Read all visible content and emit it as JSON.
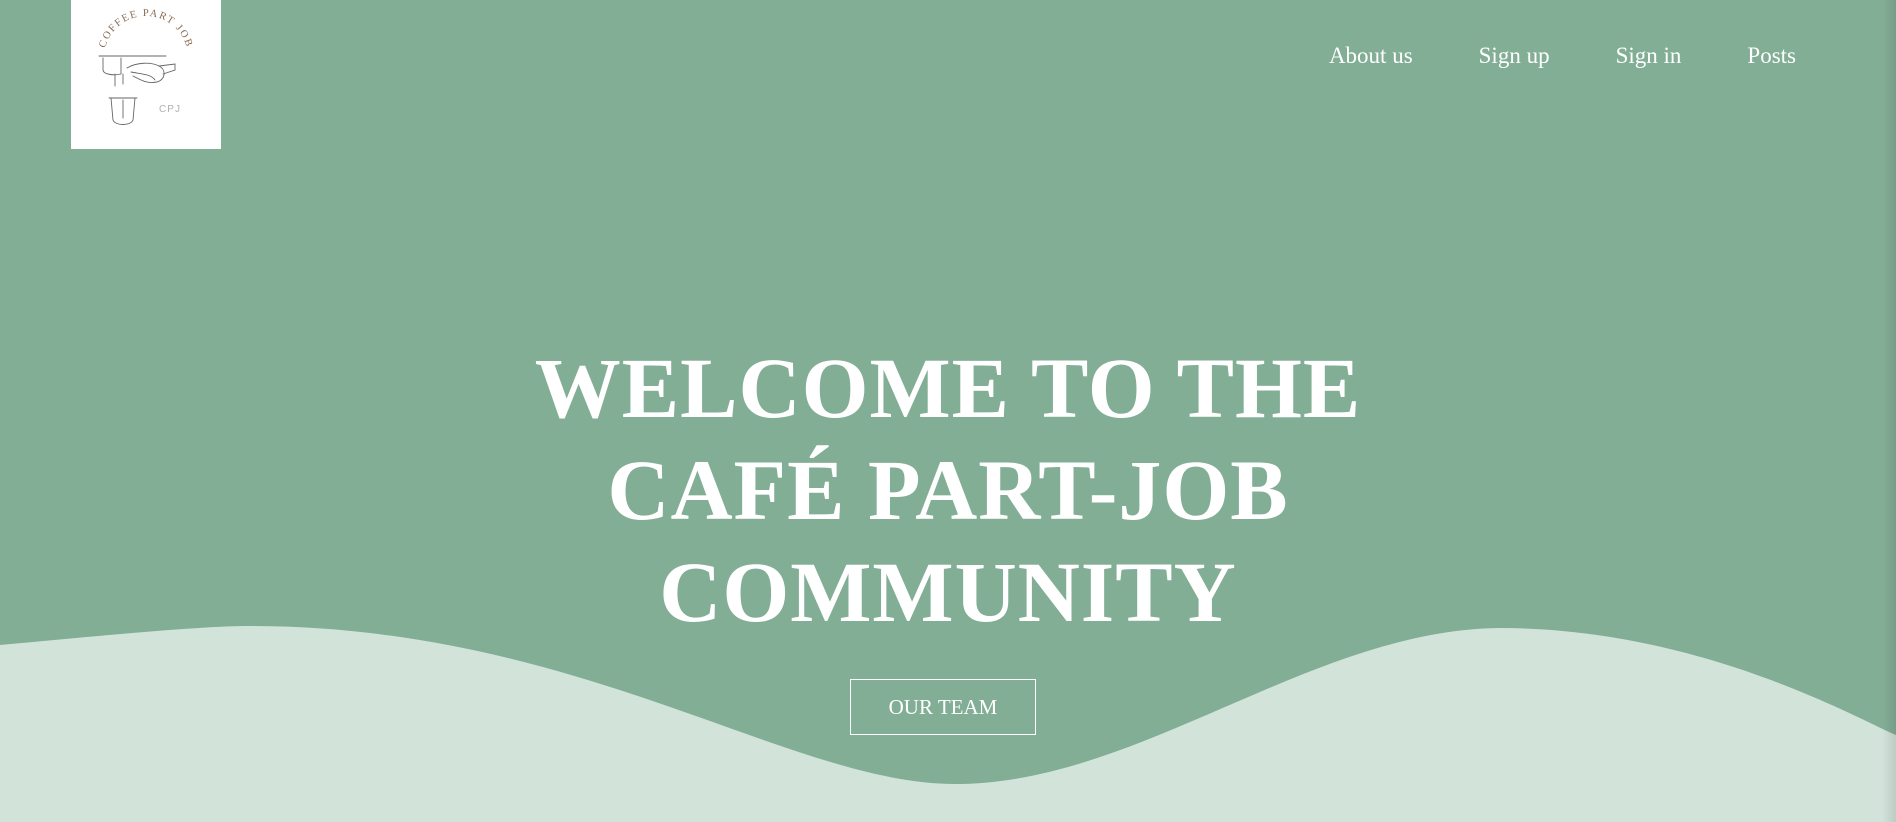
{
  "logo": {
    "alt": "Coffee Part Job logo",
    "arc_text": "COFFEE PART JOB",
    "monogram": "CPJ"
  },
  "nav": {
    "items": [
      {
        "label": "About us"
      },
      {
        "label": "Sign up"
      },
      {
        "label": "Sign in"
      },
      {
        "label": "Posts"
      }
    ]
  },
  "hero": {
    "title_line1": "WELCOME TO THE",
    "title_line2": "CAFÉ PART-JOB",
    "title_line3": "COMMUNITY",
    "button_label": "OUR TEAM"
  },
  "colors": {
    "hero_background": "#83ae96",
    "wave_fill": "#d2e3da",
    "text": "#ffffff",
    "logo_background": "#ffffff"
  }
}
